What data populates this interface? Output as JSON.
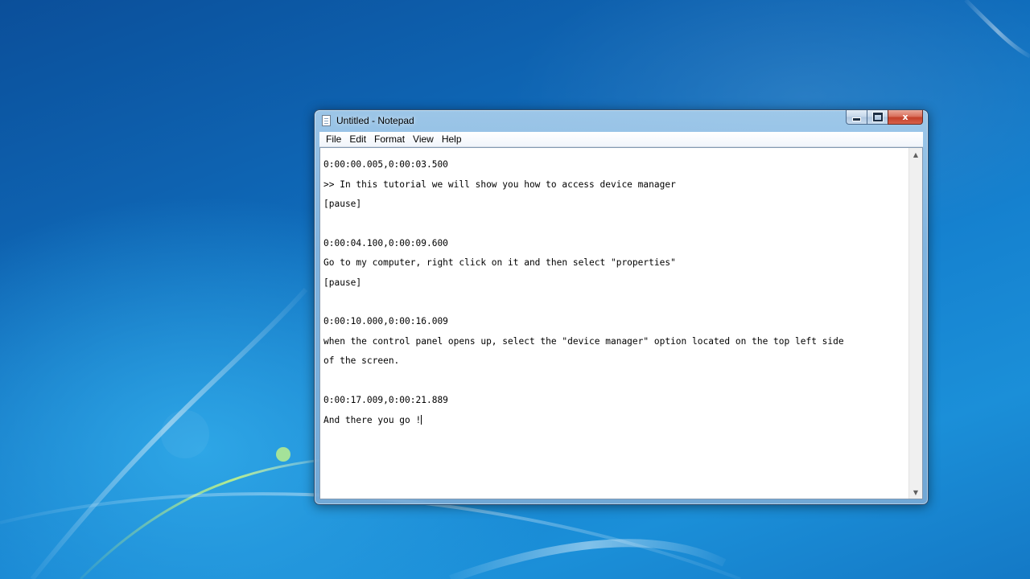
{
  "window": {
    "title": "Untitled - Notepad",
    "caption_close": "x"
  },
  "menu": [
    {
      "label": "File",
      "name": "menu-file"
    },
    {
      "label": "Edit",
      "name": "menu-edit"
    },
    {
      "label": "Format",
      "name": "menu-format"
    },
    {
      "label": "View",
      "name": "menu-view"
    },
    {
      "label": "Help",
      "name": "menu-help"
    }
  ],
  "editor": {
    "lines": [
      "0:00:00.005,0:00:03.500",
      ">> In this tutorial we will show you how to access device manager",
      "[pause]",
      "",
      "0:00:04.100,0:00:09.600",
      "Go to my computer, right click on it and then select \"properties\"",
      "[pause]",
      "",
      "0:00:10.000,0:00:16.009",
      "when the control panel opens up, select the \"device manager\" option located on the top left side",
      "of the screen.",
      "",
      "0:00:17.009,0:00:21.889",
      "And there you go !"
    ]
  },
  "icons": {
    "app": "notepad-icon",
    "minimize": "minimize-icon",
    "maximize": "maximize-icon",
    "close": "close-icon",
    "scroll_up": "scroll-up-arrow-icon",
    "scroll_down": "scroll-down-arrow-icon"
  },
  "colors": {
    "desktop_blue": "#1581cf",
    "window_frame": "#a8ceec",
    "close_button": "#c4412a"
  }
}
